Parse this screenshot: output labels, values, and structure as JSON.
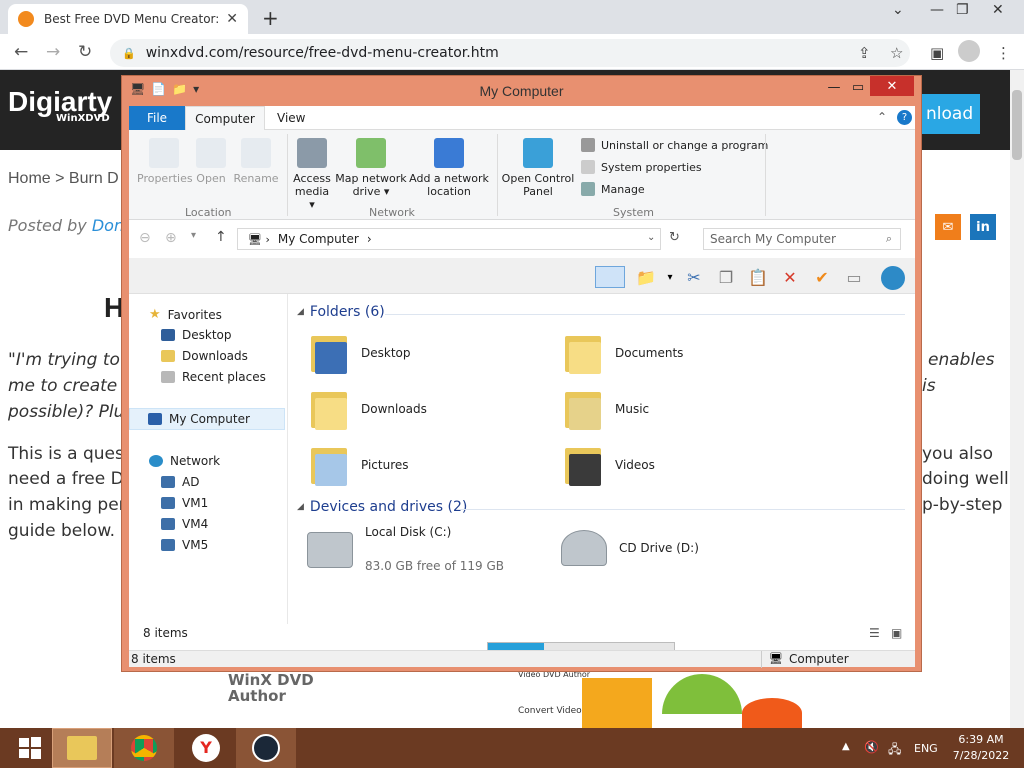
{
  "browser": {
    "tab_title": "Best Free DVD Menu Creator: Ma",
    "url": "winxdvd.com/resource/free-dvd-menu-creator.htm"
  },
  "site": {
    "logo": "Digiarty",
    "logo_sub": "WinXDVD",
    "download_fragment": "nload",
    "breadcrumb": "Home > Burn D",
    "posted_prefix": "Posted by ",
    "posted_author": "Donn",
    "heading_fragment": "H",
    "quote_lines": [
      "\"I'm trying to b",
      "me to create D",
      "possible)? Plus,"
    ],
    "quote_right": [
      "enables",
      "is"
    ],
    "para_lines": [
      "This is a questi",
      "need a free DV",
      "in making perso",
      "guide below."
    ],
    "para_right": [
      "you also",
      "doing well",
      "p-by-step"
    ],
    "banner_text": [
      "WinX DVD",
      "Author",
      "Video DVD Author",
      "Convert Video to"
    ]
  },
  "explorer": {
    "title": "My Computer",
    "ribbon_tabs": [
      "File",
      "Computer",
      "View"
    ],
    "location_buttons": [
      "Properties",
      "Open",
      "Rename"
    ],
    "network_buttons": [
      [
        "Access",
        "media ▾"
      ],
      [
        "Map network",
        "drive ▾"
      ],
      [
        "Add a network",
        "location"
      ]
    ],
    "control_panel": [
      "Open Control",
      "Panel"
    ],
    "system_items": [
      "Uninstall or change a program",
      "System properties",
      "Manage"
    ],
    "groups": [
      "Location",
      "Network",
      "System"
    ],
    "path": "My Computer",
    "search_placeholder": "Search My Computer",
    "nav": {
      "favorites": "Favorites",
      "favorites_items": [
        "Desktop",
        "Downloads",
        "Recent places"
      ],
      "computer": "My Computer",
      "network": "Network",
      "network_items": [
        "AD",
        "VM1",
        "VM4",
        "VM5"
      ]
    },
    "folders_header": "Folders (6)",
    "folders": [
      "Desktop",
      "Documents",
      "Downloads",
      "Music",
      "Pictures",
      "Videos"
    ],
    "drives_header": "Devices and drives (2)",
    "drives": [
      {
        "name": "Local Disk (C:)",
        "free": "83.0 GB free of 119 GB",
        "used_fraction": 0.3
      },
      {
        "name": "CD Drive (D:)"
      }
    ],
    "item_count": "8 items",
    "status_count": "8 items",
    "status_right": "Computer"
  },
  "taskbar": {
    "lang": "ENG",
    "time": "6:39 AM",
    "date": "7/28/2022"
  }
}
